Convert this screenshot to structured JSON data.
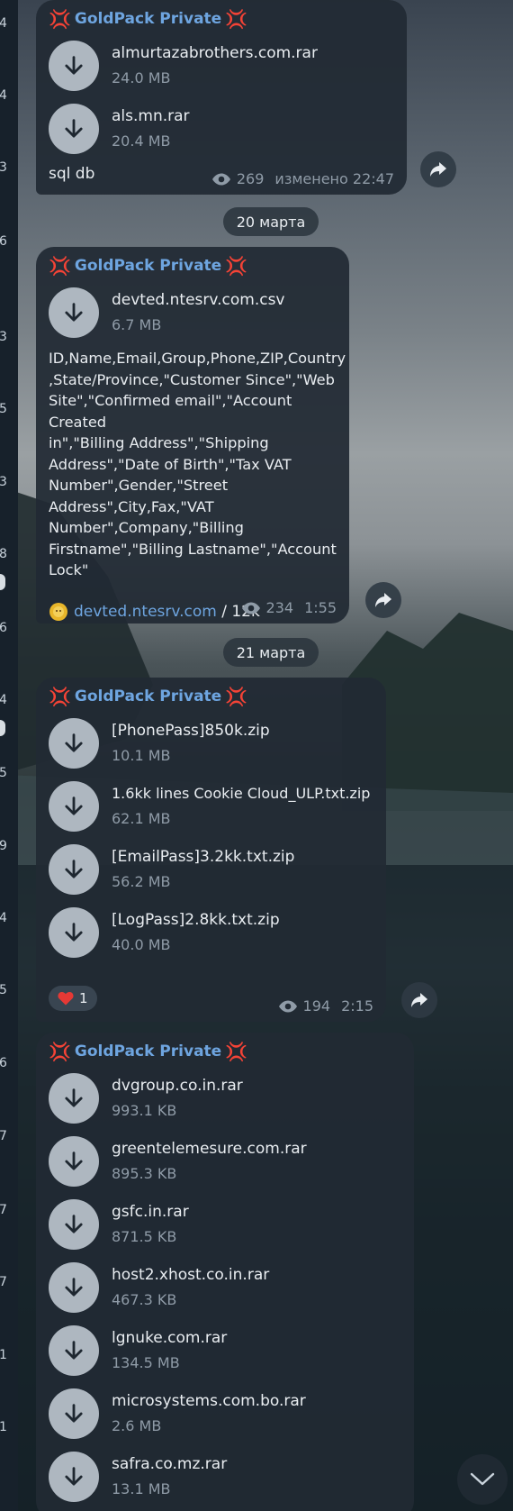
{
  "sidebar_digits": [
    "4",
    "4",
    "3",
    "6",
    "3",
    "5",
    "3",
    "8",
    "6",
    "4",
    "5",
    "9",
    "4",
    "5",
    "6",
    "7",
    "7",
    "7",
    "1",
    "1"
  ],
  "messages": [
    {
      "sender": "GoldPack Private",
      "files": [
        {
          "name": "almurtazabrothers.com.rar",
          "size": "24.0 MB"
        },
        {
          "name": "als.mn.rar",
          "size": "20.4 MB"
        }
      ],
      "caption": "sql db",
      "views": "269",
      "time": "изменено 22:47"
    },
    {
      "sender": "GoldPack Private",
      "files": [
        {
          "name": "devted.ntesrv.com.csv",
          "size": "6.7 MB"
        }
      ],
      "text_lines": [
        "ID,Name,Email,Group,Phone,ZIP,Country",
        ",State/Province,\"Customer Since\",\"Web",
        "Site\",\"Confirmed email\",\"Account Created",
        "in\",\"Billing Address\",\"Shipping",
        "Address\",\"Date of Birth\",\"Tax VAT",
        "Number\",Gender,\"Street",
        "Address\",City,Fax,\"VAT",
        "Number\",Company,\"Billing",
        "Firstname\",\"Billing Lastname\",\"Account",
        "Lock\""
      ],
      "link": "devted.ntesrv.com",
      "link_suffix": " / 12k",
      "views": "234",
      "time": "1:55"
    },
    {
      "sender": "GoldPack Private",
      "files": [
        {
          "name": "[PhonePass]850k.zip",
          "size": "10.1 MB"
        },
        {
          "name": "1.6kk lines Cookie Cloud_ULP.txt.zip",
          "size": "62.1 MB"
        },
        {
          "name": "[EmailPass]3.2kk.txt.zip",
          "size": "56.2 MB"
        },
        {
          "name": "[LogPass]2.8kk.txt.zip",
          "size": "40.0 MB"
        }
      ],
      "reaction_count": "1",
      "views": "194",
      "time": "2:15"
    },
    {
      "sender": "GoldPack Private",
      "files": [
        {
          "name": "dvgroup.co.in.rar",
          "size": "993.1 KB"
        },
        {
          "name": "greentelemesure.com.rar",
          "size": "895.3 KB"
        },
        {
          "name": "gsfc.in.rar",
          "size": "871.5 KB"
        },
        {
          "name": "host2.xhost.co.in.rar",
          "size": "467.3 KB"
        },
        {
          "name": "lgnuke.com.rar",
          "size": "134.5 MB"
        },
        {
          "name": "microsystems.com.bo.rar",
          "size": "2.6 MB"
        },
        {
          "name": "safra.co.mz.rar",
          "size": "13.1 MB"
        }
      ]
    }
  ],
  "dates": [
    "20 марта",
    "21 марта"
  ],
  "colors": {
    "accent": "#6ea5e0",
    "bubble": "#212a34",
    "icon_bg": "#aeb7c0",
    "anger": "#e5483d"
  }
}
